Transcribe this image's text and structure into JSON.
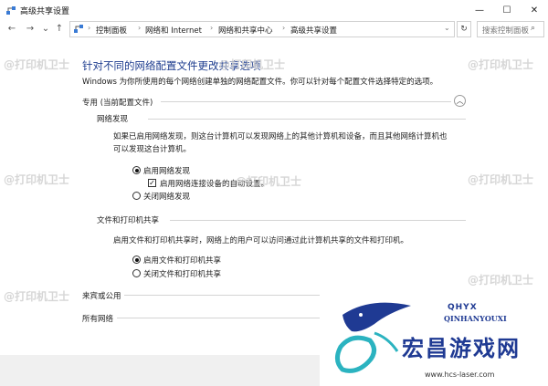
{
  "window": {
    "title": "高级共享设置",
    "minimize_glyph": "—",
    "maximize_glyph": "☐",
    "close_glyph": "✕"
  },
  "nav": {
    "back": "←",
    "forward": "→",
    "dropdown": "⌄",
    "up": "↑",
    "breadcrumbs": [
      "控制面板",
      "网络和 Internet",
      "网络和共享中心",
      "高级共享设置"
    ],
    "separator": "›",
    "refresh": "↻",
    "search_placeholder": "搜索控制面板",
    "search_icon": "⌕"
  },
  "page": {
    "heading": "针对不同的网络配置文件更改共享选项",
    "description": "Windows 为你所使用的每个网络创建单独的网络配置文件。你可以针对每个配置文件选择特定的选项。"
  },
  "sections": {
    "private": {
      "label": "专用 (当前配置文件)",
      "chevron": "︿",
      "network_discovery": {
        "title": "网络发现",
        "text_line1": "如果已启用网络发现，则这台计算机可以发现网络上的其他计算机和设备，而且其他网络计算机也",
        "text_line2": "可以发现这台计算机。",
        "options": {
          "on": "启用网络发现",
          "auto": "启用网络连接设备的自动设置。",
          "off": "关闭网络发现"
        },
        "check_mark": "✓"
      },
      "file_sharing": {
        "title": "文件和打印机共享",
        "text": "启用文件和打印机共享时，网络上的用户可以访问通过此计算机共享的文件和打印机。",
        "options": {
          "on": "启用文件和打印机共享",
          "off": "关闭文件和打印机共享"
        }
      }
    },
    "guest_public": {
      "label": "来宾或公用"
    },
    "all_networks": {
      "label": "所有网络"
    }
  },
  "watermark": "@打印机卫士",
  "brand": {
    "badge": "QHYX",
    "english": "QINHANYOUXI",
    "title": "宏昌游戏网",
    "url": "www.hcs-laser.com"
  },
  "colors": {
    "heading": "#1e3d8f",
    "brand": "#1f3a93",
    "brand_accent": "#2bb3c0"
  }
}
